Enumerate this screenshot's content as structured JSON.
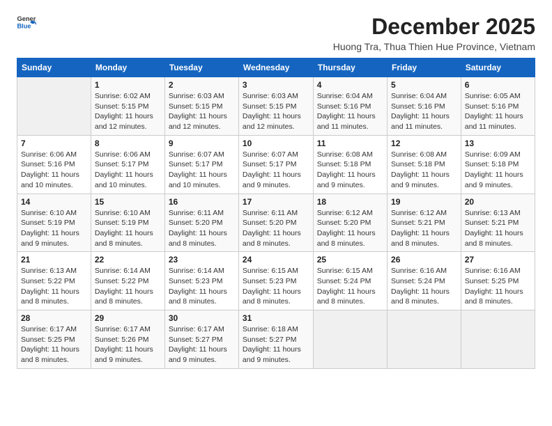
{
  "header": {
    "logo_general": "General",
    "logo_blue": "Blue",
    "month_title": "December 2025",
    "subtitle": "Huong Tra, Thua Thien Hue Province, Vietnam"
  },
  "days_of_week": [
    "Sunday",
    "Monday",
    "Tuesday",
    "Wednesday",
    "Thursday",
    "Friday",
    "Saturday"
  ],
  "weeks": [
    [
      {
        "day": "",
        "sunrise": "",
        "sunset": "",
        "daylight": ""
      },
      {
        "day": "1",
        "sunrise": "6:02 AM",
        "sunset": "5:15 PM",
        "daylight": "11 hours and 12 minutes."
      },
      {
        "day": "2",
        "sunrise": "6:03 AM",
        "sunset": "5:15 PM",
        "daylight": "11 hours and 12 minutes."
      },
      {
        "day": "3",
        "sunrise": "6:03 AM",
        "sunset": "5:15 PM",
        "daylight": "11 hours and 12 minutes."
      },
      {
        "day": "4",
        "sunrise": "6:04 AM",
        "sunset": "5:16 PM",
        "daylight": "11 hours and 11 minutes."
      },
      {
        "day": "5",
        "sunrise": "6:04 AM",
        "sunset": "5:16 PM",
        "daylight": "11 hours and 11 minutes."
      },
      {
        "day": "6",
        "sunrise": "6:05 AM",
        "sunset": "5:16 PM",
        "daylight": "11 hours and 11 minutes."
      }
    ],
    [
      {
        "day": "7",
        "sunrise": "6:06 AM",
        "sunset": "5:16 PM",
        "daylight": "11 hours and 10 minutes."
      },
      {
        "day": "8",
        "sunrise": "6:06 AM",
        "sunset": "5:17 PM",
        "daylight": "11 hours and 10 minutes."
      },
      {
        "day": "9",
        "sunrise": "6:07 AM",
        "sunset": "5:17 PM",
        "daylight": "11 hours and 10 minutes."
      },
      {
        "day": "10",
        "sunrise": "6:07 AM",
        "sunset": "5:17 PM",
        "daylight": "11 hours and 9 minutes."
      },
      {
        "day": "11",
        "sunrise": "6:08 AM",
        "sunset": "5:18 PM",
        "daylight": "11 hours and 9 minutes."
      },
      {
        "day": "12",
        "sunrise": "6:08 AM",
        "sunset": "5:18 PM",
        "daylight": "11 hours and 9 minutes."
      },
      {
        "day": "13",
        "sunrise": "6:09 AM",
        "sunset": "5:18 PM",
        "daylight": "11 hours and 9 minutes."
      }
    ],
    [
      {
        "day": "14",
        "sunrise": "6:10 AM",
        "sunset": "5:19 PM",
        "daylight": "11 hours and 9 minutes."
      },
      {
        "day": "15",
        "sunrise": "6:10 AM",
        "sunset": "5:19 PM",
        "daylight": "11 hours and 8 minutes."
      },
      {
        "day": "16",
        "sunrise": "6:11 AM",
        "sunset": "5:20 PM",
        "daylight": "11 hours and 8 minutes."
      },
      {
        "day": "17",
        "sunrise": "6:11 AM",
        "sunset": "5:20 PM",
        "daylight": "11 hours and 8 minutes."
      },
      {
        "day": "18",
        "sunrise": "6:12 AM",
        "sunset": "5:20 PM",
        "daylight": "11 hours and 8 minutes."
      },
      {
        "day": "19",
        "sunrise": "6:12 AM",
        "sunset": "5:21 PM",
        "daylight": "11 hours and 8 minutes."
      },
      {
        "day": "20",
        "sunrise": "6:13 AM",
        "sunset": "5:21 PM",
        "daylight": "11 hours and 8 minutes."
      }
    ],
    [
      {
        "day": "21",
        "sunrise": "6:13 AM",
        "sunset": "5:22 PM",
        "daylight": "11 hours and 8 minutes."
      },
      {
        "day": "22",
        "sunrise": "6:14 AM",
        "sunset": "5:22 PM",
        "daylight": "11 hours and 8 minutes."
      },
      {
        "day": "23",
        "sunrise": "6:14 AM",
        "sunset": "5:23 PM",
        "daylight": "11 hours and 8 minutes."
      },
      {
        "day": "24",
        "sunrise": "6:15 AM",
        "sunset": "5:23 PM",
        "daylight": "11 hours and 8 minutes."
      },
      {
        "day": "25",
        "sunrise": "6:15 AM",
        "sunset": "5:24 PM",
        "daylight": "11 hours and 8 minutes."
      },
      {
        "day": "26",
        "sunrise": "6:16 AM",
        "sunset": "5:24 PM",
        "daylight": "11 hours and 8 minutes."
      },
      {
        "day": "27",
        "sunrise": "6:16 AM",
        "sunset": "5:25 PM",
        "daylight": "11 hours and 8 minutes."
      }
    ],
    [
      {
        "day": "28",
        "sunrise": "6:17 AM",
        "sunset": "5:25 PM",
        "daylight": "11 hours and 8 minutes."
      },
      {
        "day": "29",
        "sunrise": "6:17 AM",
        "sunset": "5:26 PM",
        "daylight": "11 hours and 9 minutes."
      },
      {
        "day": "30",
        "sunrise": "6:17 AM",
        "sunset": "5:27 PM",
        "daylight": "11 hours and 9 minutes."
      },
      {
        "day": "31",
        "sunrise": "6:18 AM",
        "sunset": "5:27 PM",
        "daylight": "11 hours and 9 minutes."
      },
      {
        "day": "",
        "sunrise": "",
        "sunset": "",
        "daylight": ""
      },
      {
        "day": "",
        "sunrise": "",
        "sunset": "",
        "daylight": ""
      },
      {
        "day": "",
        "sunrise": "",
        "sunset": "",
        "daylight": ""
      }
    ]
  ],
  "labels": {
    "sunrise_prefix": "Sunrise: ",
    "sunset_prefix": "Sunset: ",
    "daylight_prefix": "Daylight: "
  }
}
